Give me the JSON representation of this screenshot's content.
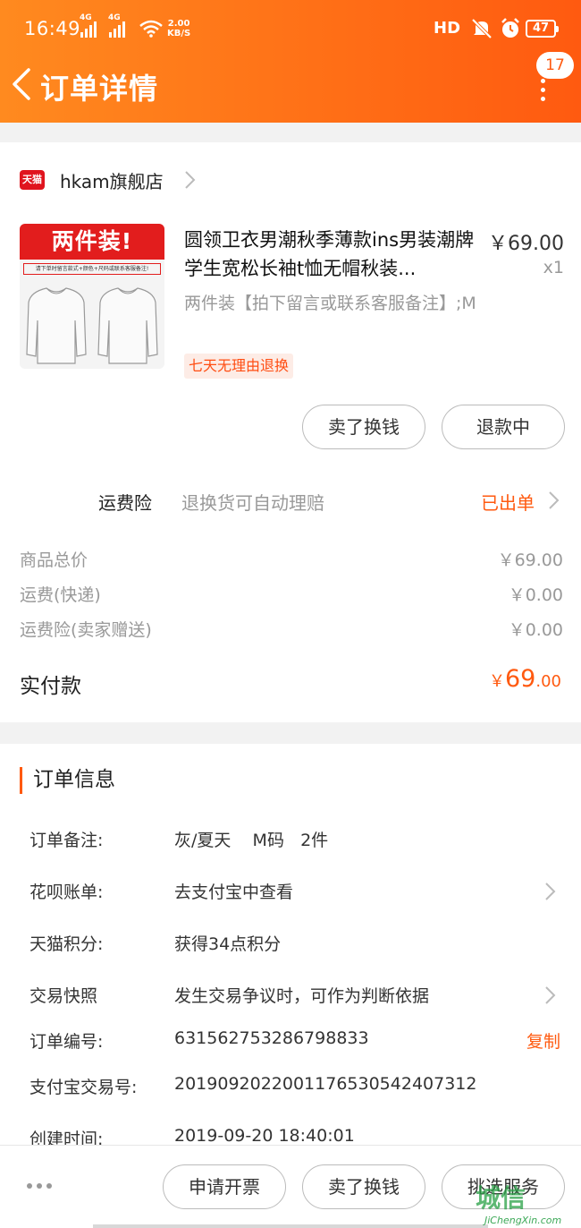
{
  "status_bar": {
    "time": "16:49",
    "net1": "4G",
    "net2": "4G",
    "speed_value": "2.00",
    "speed_unit": "KB/S",
    "hd": "HD",
    "battery": "47"
  },
  "header": {
    "title": "订单详情",
    "badge_count": "17",
    "accent_color": "#ff5a10"
  },
  "shop": {
    "logo_text": "天猫",
    "name": "hkam旗舰店"
  },
  "product": {
    "thumb_banner": "两件装!",
    "thumb_subline": "请下单时留言款式+颜色+尺码或联系客服备注!",
    "title": "圆领卫衣男潮秋季薄款ins男装潮牌学生宽松长袖t恤无帽秋装...",
    "price": "￥69.00",
    "quantity": "x1",
    "sku": "两件装【拍下留言或联系客服备注】;M",
    "tag": "七天无理由退换",
    "btn_sell": "卖了换钱",
    "btn_refund": "退款中"
  },
  "insurance": {
    "label": "运费险",
    "desc": "退换货可自动理赔",
    "status": "已出单"
  },
  "fees": [
    {
      "label": "商品总价",
      "value": "￥69.00"
    },
    {
      "label": "运费(快递)",
      "value": "￥0.00"
    },
    {
      "label": "运费险(卖家赠送)",
      "value": "￥0.00"
    }
  ],
  "paid": {
    "label": "实付款",
    "currency": "￥",
    "integer": "69",
    "decimal": ".00"
  },
  "order_info": {
    "section_title": "订单信息",
    "rows": [
      {
        "key": "订单备注:",
        "value": "灰/夏天    M码   2件"
      },
      {
        "key": "花呗账单:",
        "value": "去支付宝中查看"
      },
      {
        "key": "天猫积分:",
        "value": "获得34点积分"
      },
      {
        "key": "交易快照",
        "value": "发生交易争议时，可作为判断依据"
      },
      {
        "key": "订单编号:",
        "value": "631562753286798833",
        "action": "复制"
      },
      {
        "key": "支付宝交易号:",
        "value": "2019092022001176530542407312"
      },
      {
        "key": "创建时间:",
        "value": "2019-09-20 18:40:01"
      }
    ]
  },
  "bottom_bar": {
    "btn_invoice": "申请开票",
    "btn_sell": "卖了换钱",
    "btn_service": "挑选服务"
  },
  "watermark": {
    "big": "城信",
    "small": "JiChengXin.com"
  }
}
